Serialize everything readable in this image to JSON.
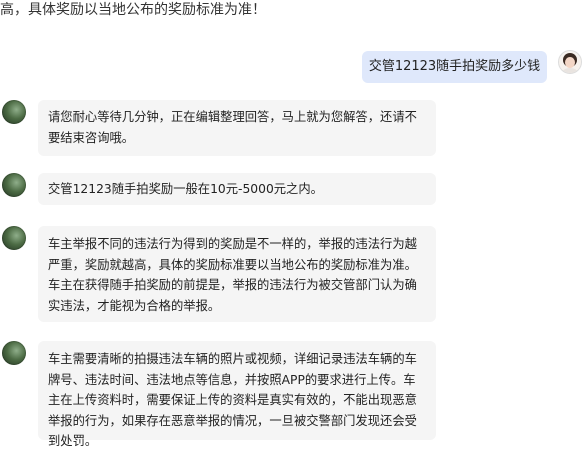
{
  "header": {
    "partial_text": "高，具体奖励以当地公布的奖励标准为准！"
  },
  "user_message": {
    "text": "交管12123随手拍奖励多少钱"
  },
  "bot_messages": [
    {
      "text": "请您耐心等待几分钟，正在编辑整理回答，马上就为您解答，还请不要结束咨询哦。"
    },
    {
      "text": "交管12123随手拍奖励一般在10元-5000元之内。"
    },
    {
      "text": "车主举报不同的违法行为得到的奖励是不一样的，举报的违法行为越严重，奖励就越高，具体的奖励标准要以当地公布的奖励标准为准。车主在获得随手拍奖励的前提是，举报的违法行为被交管部门认为确实违法，才能视为合格的举报。"
    },
    {
      "text": "车主需要清晰的拍摄违法车辆的照片或视频，详细记录违法车辆的车牌号、违法时间、违法地点等信息，并按照APP的要求进行上传。车主在上传资料时，需要保证上传的资料是真实有效的，不能出现恶意举报的行为，如果存在恶意举报的情况，一旦被交警部门发现还会受到处罚。"
    }
  ],
  "colors": {
    "user_bubble": "#dfe8fb",
    "bot_bubble": "#f5f5f5",
    "background": "#ffffff"
  }
}
